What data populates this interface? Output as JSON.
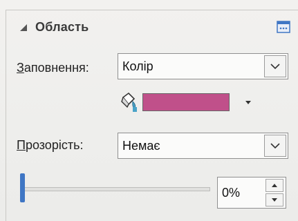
{
  "section": {
    "title": "Область",
    "collapse_icon": "triangle-down-left-icon",
    "more_icon": "more-options-icon"
  },
  "fill": {
    "label_underlined": "З",
    "label_rest": "аповнення:",
    "select_value": "Колір",
    "color": "#c0508a",
    "bucket_icon": "paint-bucket-icon",
    "dropdown_icon": "caret-down-icon"
  },
  "transparency": {
    "label_underlined": "П",
    "label_rest": "розорість:",
    "select_value": "Немає",
    "value_percent": 0,
    "value_text": "0%"
  },
  "colors": {
    "accent": "#3f76c4",
    "border": "#8f8f8f",
    "panel_background": "#eeeeec"
  }
}
